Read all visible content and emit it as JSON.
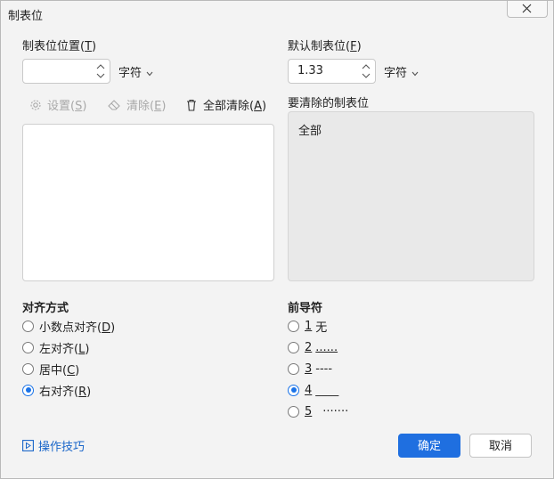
{
  "window": {
    "title": "制表位"
  },
  "tab_position": {
    "label": "制表位位置",
    "hotkey": "T",
    "value": "",
    "unit": "字符"
  },
  "default_tab": {
    "label": "默认制表位",
    "hotkey": "F",
    "value": "1.33",
    "unit": "字符"
  },
  "toolbar": {
    "set_label": "设置",
    "set_hotkey": "S",
    "clear_label": "清除",
    "clear_hotkey": "E",
    "clear_all_label": "全部清除",
    "clear_all_hotkey": "A"
  },
  "to_clear": {
    "label": "要清除的制表位",
    "value": "全部"
  },
  "alignment": {
    "title": "对齐方式",
    "options": [
      {
        "label": "小数点对齐",
        "hotkey": "D",
        "checked": false
      },
      {
        "label": "左对齐",
        "hotkey": "L",
        "checked": false
      },
      {
        "label": "居中",
        "hotkey": "C",
        "checked": false
      },
      {
        "label": "右对齐",
        "hotkey": "R",
        "checked": true
      }
    ]
  },
  "leader": {
    "title": "前导符",
    "options": [
      {
        "num": "1",
        "text": "无",
        "checked": false
      },
      {
        "num": "2",
        "text": "......",
        "checked": false
      },
      {
        "num": "3",
        "text": "----",
        "checked": false
      },
      {
        "num": "4",
        "text": "____",
        "checked": true
      },
      {
        "num": "5",
        "text": "·······",
        "checked": false
      }
    ]
  },
  "footer": {
    "tips_label": "操作技巧",
    "ok_label": "确定",
    "cancel_label": "取消"
  },
  "colors": {
    "accent": "#1f6fe0",
    "link": "#1a66c9"
  }
}
